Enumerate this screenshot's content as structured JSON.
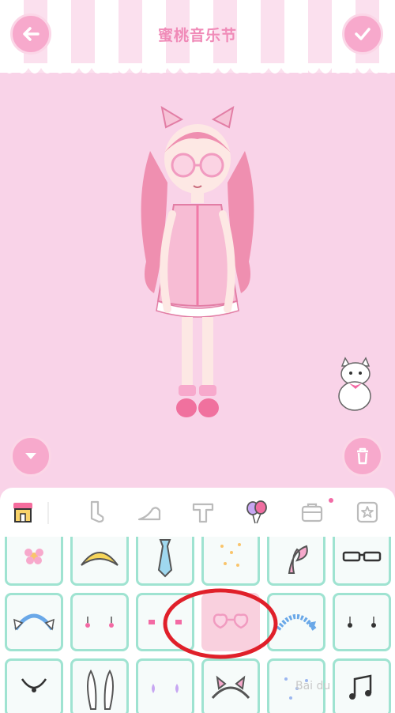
{
  "header": {
    "title": "蜜桃音乐节"
  },
  "icons": {
    "back": "arrow-left-icon",
    "confirm": "checkmark-icon",
    "collapse": "chevron-down-icon",
    "delete": "trash-icon"
  },
  "toolbar": {
    "categories": [
      "shop-icon",
      "sock-icon",
      "shoe-icon",
      "hat-t-icon",
      "balloon-icon",
      "bag-icon",
      "star-icon"
    ]
  },
  "watermark": "Bai du",
  "colors": {
    "accent": "#f7a9cc",
    "background": "#f9d3e8",
    "cell_border": "#9fe3d1",
    "annotation": "#e0202a"
  }
}
